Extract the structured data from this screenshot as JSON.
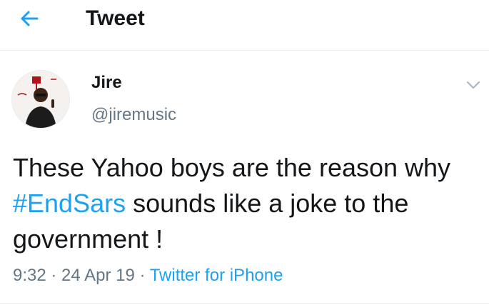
{
  "header": {
    "title": "Tweet",
    "back_icon": "arrow-left-icon"
  },
  "tweet": {
    "author": {
      "name": "Jire",
      "handle": "@jiremusic"
    },
    "text": {
      "before": "These Yahoo boys are the reason why ",
      "hashtag": "#EndSars",
      "after": " sounds like a joke to the government !"
    },
    "meta": {
      "time": "9:32",
      "separator": " · ",
      "date": "24 Apr 19",
      "source": "Twitter for iPhone"
    },
    "menu_icon": "chevron-down-icon"
  },
  "colors": {
    "accent": "#1da1f2",
    "secondary_text": "#657786",
    "primary_text": "#14171a"
  }
}
